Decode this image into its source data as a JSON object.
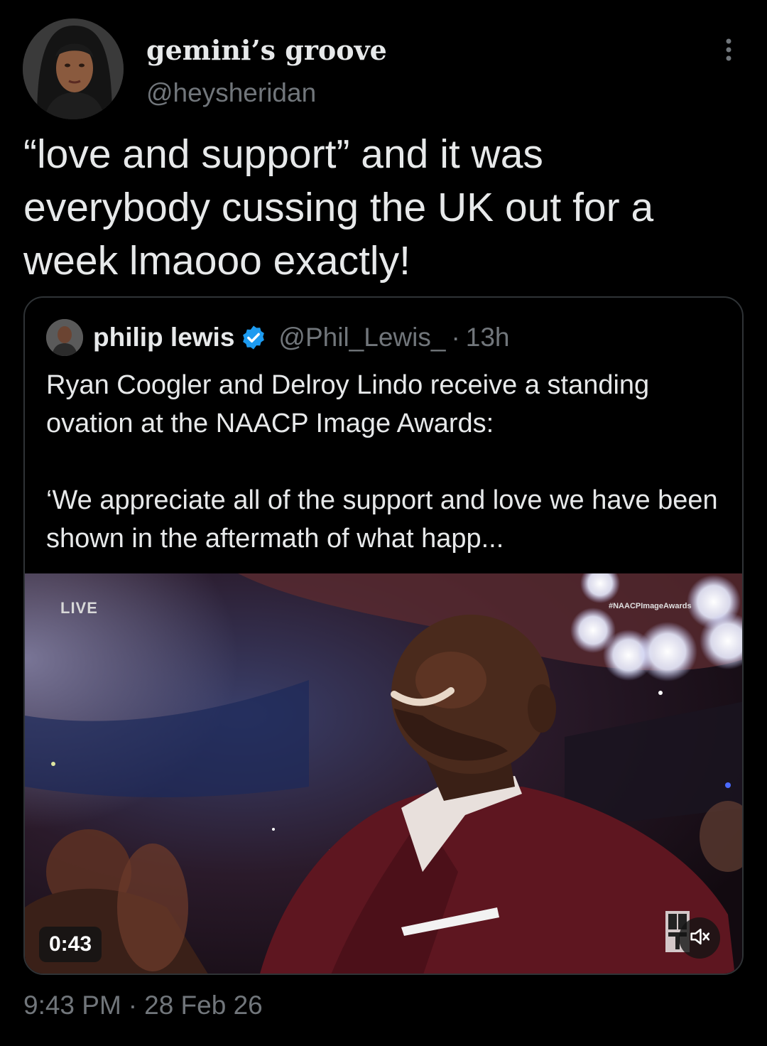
{
  "tweet": {
    "author": {
      "display_name": "gemini’s groove",
      "handle": "@heysheridan"
    },
    "text": "“love and support” and it was everybody cussing the UK out for a week lmaooo exactly!",
    "timestamp": {
      "time": "9:43 PM",
      "separator": "·",
      "date": "28 Feb 26"
    },
    "more_icon": "more-vertical-icon"
  },
  "quoted_tweet": {
    "author": {
      "display_name": "philip lewis",
      "handle": "@Phil_Lewis_",
      "verified": true,
      "verified_icon": "verified-badge-icon"
    },
    "separator": "·",
    "time_ago": "13h",
    "text": "Ryan Coogler and Delroy Lindo receive a standing ovation at the NAACP Image Awards:\n\n‘We appreciate all of the support and love we have been shown in the aftermath of what happ...",
    "video": {
      "live_label": "LIVE",
      "hashtag": "#NAACPImageAwards",
      "duration": "0:43",
      "network_logo": "BET",
      "mute_icon": "speaker-muted-icon"
    }
  },
  "colors": {
    "background": "#000000",
    "text_primary": "#e7e9ea",
    "text_secondary": "#71767b",
    "border": "#2f3336",
    "verified_blue": "#1d9bf0"
  }
}
